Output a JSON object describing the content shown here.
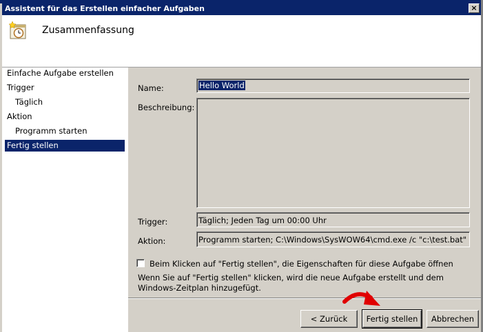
{
  "window": {
    "title": "Assistent für das Erstellen einfacher Aufgaben",
    "close_glyph": "×"
  },
  "header": {
    "title": "Zusammenfassung",
    "icon": "task-clock-icon"
  },
  "steps": [
    {
      "label": "Einfache Aufgabe erstellen",
      "active": false,
      "sub": false
    },
    {
      "label": "Trigger",
      "active": false,
      "sub": false
    },
    {
      "label": "Täglich",
      "active": false,
      "sub": true
    },
    {
      "label": "Aktion",
      "active": false,
      "sub": false
    },
    {
      "label": "Programm starten",
      "active": false,
      "sub": true
    },
    {
      "label": "Fertig stellen",
      "active": true,
      "sub": false
    }
  ],
  "form": {
    "name_label": "Name:",
    "name_value": "Hello World",
    "description_label": "Beschreibung:",
    "description_value": "",
    "trigger_label": "Trigger:",
    "trigger_value": "Täglich; Jeden Tag um 00:00 Uhr",
    "action_label": "Aktion:",
    "action_value": "Programm starten; C:\\Windows\\SysWOW64\\cmd.exe /c \"c:\\test.bat\"",
    "open_properties_label": "Beim Klicken auf \"Fertig stellen\", die Eigenschaften für diese Aufgabe öffnen",
    "open_properties_checked": false,
    "info_line1": "Wenn Sie auf \"Fertig stellen\" klicken, wird die neue Aufgabe erstellt und dem",
    "info_line2": "Windows-Zeitplan hinzugefügt."
  },
  "buttons": {
    "back": "< Zurück",
    "finish": "Fertig stellen",
    "cancel": "Abbrechen"
  },
  "colors": {
    "selection": "#0a246a",
    "dialog_bg": "#d4d0c8",
    "arrow": "#e00000"
  }
}
